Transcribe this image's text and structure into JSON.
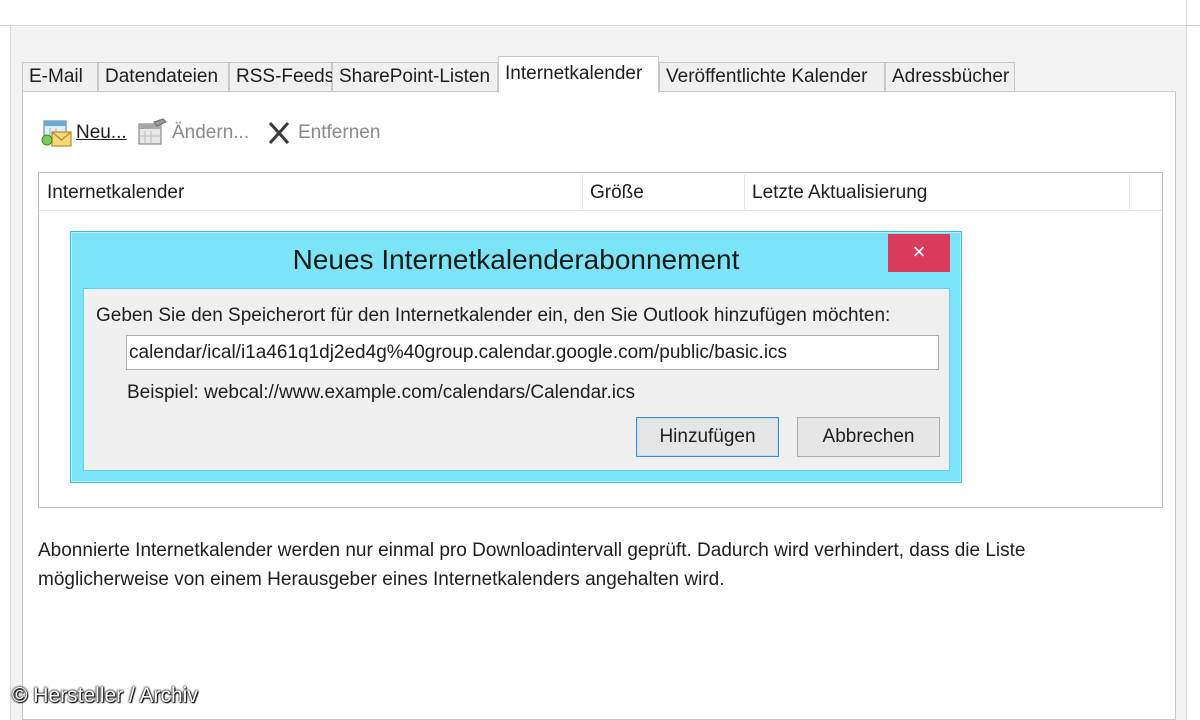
{
  "tabs": [
    {
      "label": "E-Mail"
    },
    {
      "label": "Datendateien"
    },
    {
      "label": "RSS-Feeds"
    },
    {
      "label": "SharePoint-Listen"
    },
    {
      "label": "Internetkalender",
      "active": true
    },
    {
      "label": "Veröffentlichte Kalender"
    },
    {
      "label": "Adressbücher"
    }
  ],
  "toolbar": {
    "new_label": "Neu...",
    "change_label": "Ändern...",
    "remove_label": "Entfernen",
    "new_icon": "calendar-envelope-icon",
    "change_icon": "calendar-edit-icon",
    "remove_icon": "x-delete-icon"
  },
  "list": {
    "columns": [
      "Internetkalender",
      "Größe",
      "Letzte Aktualisierung"
    ]
  },
  "dialog": {
    "title": "Neues Internetkalenderabonnement",
    "close_label": "×",
    "prompt": "Geben Sie den Speicherort für den Internetkalender ein, den Sie Outlook hinzufügen möchten:",
    "url_value": "calendar/ical/i1a461q1dj2ed4g%40group.calendar.google.com/public/basic.ics",
    "example": "Beispiel: webcal://www.example.com/calendars/Calendar.ics",
    "add_label": "Hinzufügen",
    "cancel_label": "Abbrechen",
    "frame_color": "#7de3f6",
    "close_color": "#d93b5b"
  },
  "info": {
    "line1": "Abonnierte Internetkalender werden nur einmal pro Downloadintervall geprüft. Dadurch wird verhindert, dass die Liste",
    "line2": "möglicherweise von einem Herausgeber eines Internetkalenders angehalten wird."
  },
  "watermark": "© Hersteller / Archiv"
}
